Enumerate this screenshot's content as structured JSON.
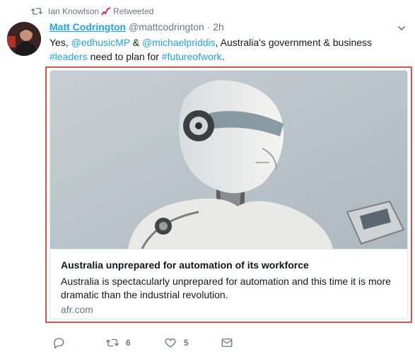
{
  "retweet": {
    "user": "Ian Knowlson",
    "label": "Retweeted"
  },
  "tweet": {
    "name": "Matt Codrington",
    "handle": "@mattcodrington",
    "separator": "·",
    "time": "2h",
    "text_parts": {
      "p1": "Yes, ",
      "m1": "@edhusicMP",
      "p2": " & ",
      "m2": "@michaelpriddis",
      "p3": ", Australia's government & business",
      "h1": "#leaders",
      "p4": " need to plan for ",
      "h2": "#futureofwork",
      "p5": "."
    }
  },
  "card": {
    "title": "Australia unprepared for automation of its workforce",
    "description": "Australia is spectacularly unprepared for automation and this time it is more dramatic than the industrial revolution.",
    "domain": "afr.com"
  },
  "actions": {
    "reply_count": "",
    "retweet_count": "6",
    "like_count": "5"
  },
  "icons": {
    "retweet": "retweet-icon",
    "chart": "chart-increasing-icon",
    "caret": "chevron-down-icon",
    "reply": "reply-icon",
    "like": "heart-icon",
    "dm": "envelope-icon"
  },
  "colors": {
    "link": "#1da1f2",
    "muted": "#657786",
    "highlight": "#d9534f"
  }
}
